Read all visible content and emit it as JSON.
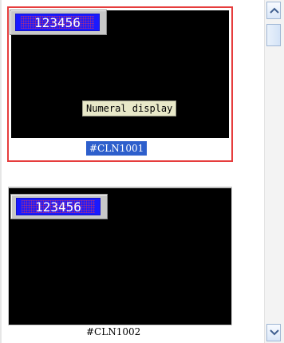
{
  "thumbnails": [
    {
      "id_label": "#CLN1001",
      "selected": true,
      "widget_value": "123456",
      "tooltip": "Numeral display"
    },
    {
      "id_label": "#CLN1002",
      "selected": false,
      "widget_value": "123456"
    }
  ],
  "colors": {
    "selection_border": "#e63d3d",
    "screen_bg": "#000000",
    "numeral_bg": "#1a1aff",
    "tooltip_bg": "#e8e8c8",
    "caption_selected_bg": "#2d5fcc"
  },
  "icons": {
    "scroll_up": "chevron-up-icon",
    "scroll_down": "chevron-down-icon"
  }
}
